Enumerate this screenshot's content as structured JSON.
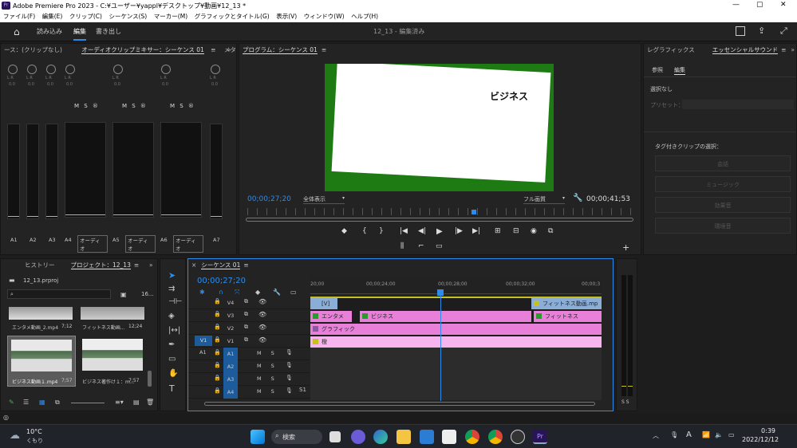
{
  "app": {
    "title": "Adobe Premiere Pro 2023 - C:¥ユーザー¥yappl¥デスクトップ¥動画¥12_13 *",
    "icon": "Pr"
  },
  "menu": [
    "ファイル(F)",
    "編集(E)",
    "クリップ(C)",
    "シーケンス(S)",
    "マーカー(M)",
    "グラフィックとタイトル(G)",
    "表示(V)",
    "ウィンドウ(W)",
    "ヘルプ(H)"
  ],
  "workspace": {
    "tabs": [
      "読み込み",
      "編集",
      "書き出し"
    ],
    "active": "編集",
    "center": "12_13 - 編集済み"
  },
  "mixer": {
    "tab1": "ース：(クリップなし)",
    "tab2": "オーディオクリップミキサー：シーケンス 01",
    "tab3": "メタ",
    "channels": [
      "A1",
      "A2",
      "A3",
      "A4",
      "A5",
      "A6",
      "A7"
    ],
    "audio_label": "オーディオ",
    "lr": "L   R",
    "zero": "0.0",
    "msr": "M S ®"
  },
  "program": {
    "title": "プログラム：シーケンス 01",
    "overlay": "ビジネス",
    "timecode": "00;00;27;20",
    "fit": "全体表示",
    "quality": "フル画質",
    "duration": "00;00;41;53"
  },
  "essential": {
    "tab_graphics": "レグラフィックス",
    "tab_sound": "エッセンシャルサウンド",
    "sub": [
      "参照",
      "編集"
    ],
    "no_sel": "選択なし",
    "preset": "プリセット：",
    "tag_title": "タグ付きクリップの選択：",
    "tags": [
      "会話",
      "ミュージック",
      "効果音",
      "環境音"
    ]
  },
  "project": {
    "tab_history": "ヒストリー",
    "tab_project": "プロジェクト：12_13",
    "file": "12_13.prproj",
    "count": "16...",
    "items": [
      {
        "name": "エンタメ動画_2.mp4",
        "dur": "7;12"
      },
      {
        "name": "フィットネス動画...",
        "dur": "12;24"
      },
      {
        "name": "ビジネス動画１.mp4",
        "dur": "7;57"
      },
      {
        "name": "ビジネス著作け１：m...",
        "dur": "7;57"
      }
    ]
  },
  "timeline": {
    "title": "シーケンス 01",
    "timecode": "00;00;27;20",
    "ruler": [
      "20;00",
      "00;00;24;00",
      "00;00;28;00",
      "00;00;32;00",
      "00;00;3"
    ],
    "tracks_v": [
      "V4",
      "V3",
      "V2",
      "V1"
    ],
    "tracks_a": [
      "A1",
      "A2",
      "A3",
      "A4"
    ],
    "src_v": "V1",
    "src_a": "A1",
    "ms": "M S",
    "clips": {
      "v4a": "[V]",
      "v4b": "フィットネス動画.mp",
      "v3a": "エンタメ",
      "v3b": "ビジネス",
      "v3c": "フィットネス",
      "v2": "グラフィック",
      "v1": "橙"
    },
    "db": "S S",
    "s1": "S1"
  },
  "taskbar": {
    "temp": "10°C",
    "weather": "くもり",
    "search": "検索",
    "time": "0:39",
    "date": "2022/12/12",
    "ime": "A"
  },
  "colors": {
    "accent": "#2d8ceb",
    "clip_pink": "#e87fd9",
    "clip_light": "#f7b4ee",
    "clip_blue": "#8aaed8",
    "green": "#1e7a12",
    "meter": "#c8c020"
  }
}
